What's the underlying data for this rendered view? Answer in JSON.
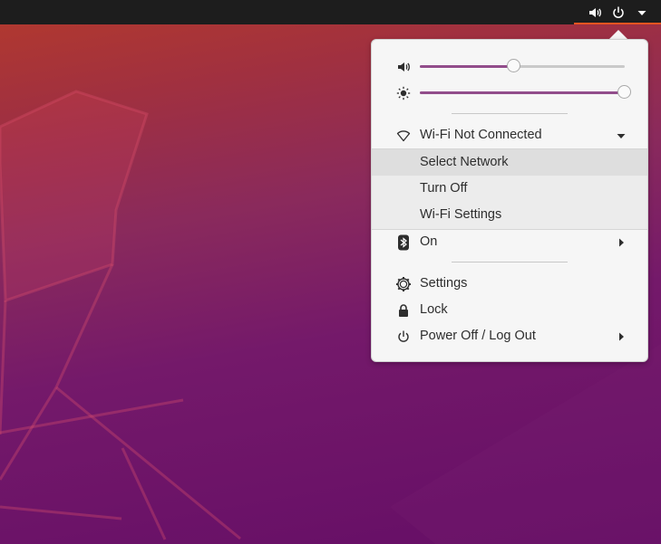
{
  "tray": {
    "icons": [
      "volume-icon",
      "power-icon",
      "dropdown-arrow-icon"
    ]
  },
  "menu": {
    "volume": {
      "icon": "volume-icon",
      "level": 0.46
    },
    "brightness": {
      "icon": "brightness-icon",
      "level": 1.0
    },
    "wifi": {
      "icon": "wifi-icon",
      "label": "Wi-Fi Not Connected",
      "submenu": [
        {
          "label": "Select Network",
          "highlighted": true
        },
        {
          "label": "Turn Off"
        },
        {
          "label": "Wi-Fi Settings"
        }
      ]
    },
    "bluetooth": {
      "icon": "bluetooth-icon",
      "label": "On"
    },
    "settings": {
      "icon": "gear-icon",
      "label": "Settings"
    },
    "lock": {
      "icon": "lock-icon",
      "label": "Lock"
    },
    "power": {
      "icon": "power-icon",
      "label": "Power Off / Log Out"
    }
  },
  "colors": {
    "topbar": "#1d1d1d",
    "accent": "#e95420",
    "slider_fill": "#924d8b",
    "menu_bg": "#f6f6f6"
  }
}
